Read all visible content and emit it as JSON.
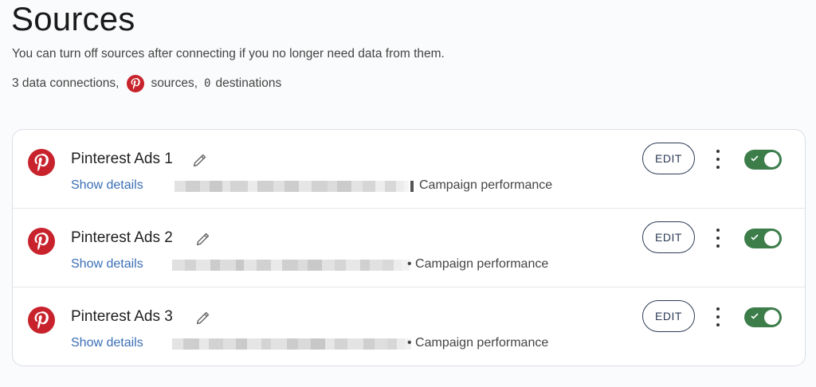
{
  "page": {
    "title": "Sources",
    "subtitle": "You can turn off sources after connecting if you no longer need data from them.",
    "summary": {
      "connections": "3 data connections,",
      "sources": "sources,",
      "destinations_count": "0",
      "destinations": "destinations"
    }
  },
  "rows": [
    {
      "name": "Pinterest Ads 1",
      "details_label": "Show details",
      "meta": "Campaign performance",
      "edit_label": "EDIT",
      "enabled": true
    },
    {
      "name": "Pinterest Ads 2",
      "details_label": "Show details",
      "meta": "• Campaign performance",
      "edit_label": "EDIT",
      "enabled": true
    },
    {
      "name": "Pinterest Ads 3",
      "details_label": "Show details",
      "meta": "• Campaign performance",
      "edit_label": "EDIT",
      "enabled": true
    }
  ],
  "icons": {
    "source_logo": "pinterest-icon",
    "rename": "pencil-icon",
    "more": "kebab-menu-icon",
    "toggle_check": "check-icon"
  },
  "colors": {
    "pinterest_red": "#c8232c",
    "link_blue": "#3b6fb6",
    "toggle_green": "#3c7d4a",
    "button_navy": "#2b3a55"
  }
}
